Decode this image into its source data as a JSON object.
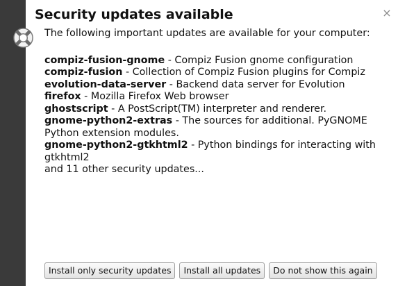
{
  "notification": {
    "title": "Security updates available",
    "intro": "The following important updates are available for your computer:",
    "icon": "lifebuoy-icon",
    "close_icon": "close-icon",
    "packages": [
      {
        "name": "compiz-fusion-gnome",
        "description": " - Compiz Fusion gnome configuration"
      },
      {
        "name": "compiz-fusion",
        "description": " - Collection of Compiz Fusion plugins for Compiz"
      },
      {
        "name": "evolution-data-server",
        "description": " - Backend data server for Evolution"
      },
      {
        "name": "firefox",
        "description": " - Mozilla Firefox Web browser"
      },
      {
        "name": "ghostscript",
        "description": " - A PostScript(TM) interpreter and renderer."
      },
      {
        "name": "gnome-python2-extras",
        "description": " - The sources for additional. PyGNOME Python extension modules."
      },
      {
        "name": "gnome-python2-gtkhtml2",
        "description": " - Python bindings for interacting with gtkhtml2"
      }
    ],
    "more_text": "and 11 other security updates...",
    "buttons": {
      "install_security": "Install only security updates",
      "install_all": "Install all updates",
      "dont_show": "Do not show this again"
    }
  },
  "colors": {
    "sidebar": "#3a3a3a",
    "background": "#ffffff",
    "button_border": "#9c9c9c"
  }
}
